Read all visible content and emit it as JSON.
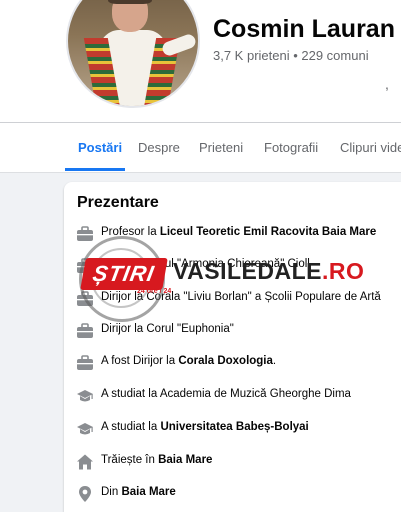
{
  "profile": {
    "name": "Cosmin Lauran",
    "stats": "3,7 K prieteni • 229 comuni",
    "tick": ","
  },
  "tabs": [
    {
      "label": "Postări",
      "active": true
    },
    {
      "label": "Despre",
      "active": false
    },
    {
      "label": "Prieteni",
      "active": false
    },
    {
      "label": "Fotografii",
      "active": false
    },
    {
      "label": "Clipuri video",
      "active": false
    }
  ],
  "intro": {
    "title": "Prezentare",
    "items": [
      {
        "icon": "briefcase-icon",
        "pre": "Profesor la ",
        "bold": "Liceul Teoretic Emil Racovita Baia Mare",
        "post": ""
      },
      {
        "icon": "briefcase-icon",
        "pre": "Dirijor la Corul \"Armonia Chioreană\" Cioll",
        "bold": "",
        "post": ""
      },
      {
        "icon": "briefcase-icon",
        "pre": "Dirijor la Corala \"Liviu Borlan\" a Școlii Populare de Artă",
        "bold": "",
        "post": ""
      },
      {
        "icon": "briefcase-icon",
        "pre": "Dirijor la Corul \"Euphonia\"",
        "bold": "",
        "post": ""
      },
      {
        "icon": "briefcase-icon",
        "pre": "A fost Dirijor la ",
        "bold": "Corala Doxologia",
        "post": "."
      },
      {
        "icon": "graduation-cap-icon",
        "pre": "A studiat la Academia de Muzică Gheorghe Dima",
        "bold": "",
        "post": ""
      },
      {
        "icon": "graduation-cap-icon",
        "pre": "A studiat la ",
        "bold": "Universitatea Babeș-Bolyai",
        "post": ""
      },
      {
        "icon": "home-icon",
        "pre": "Trăiește în ",
        "bold": "Baia Mare",
        "post": ""
      },
      {
        "icon": "location-pin-icon",
        "pre": "Din ",
        "bold": "Baia Mare",
        "post": ""
      }
    ]
  },
  "watermark": {
    "badge": "ȘTIRI",
    "sub": "24 ore / 24",
    "site_main": "VASILEDALE",
    "site_tld": ".RO"
  },
  "colors": {
    "accent": "#1877f2",
    "icon": "#8a8d91",
    "watermark_red": "#d7191f"
  }
}
